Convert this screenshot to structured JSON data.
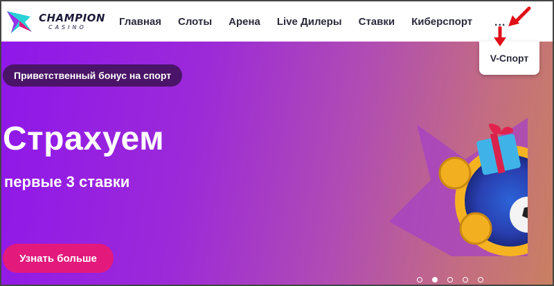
{
  "logo": {
    "name": "CHAMPION",
    "sub": "CASINO"
  },
  "nav": {
    "items": [
      {
        "label": "Главная"
      },
      {
        "label": "Слоты"
      },
      {
        "label": "Арена"
      },
      {
        "label": "Live Дилеры"
      },
      {
        "label": "Ставки"
      },
      {
        "label": "Киберспорт"
      }
    ],
    "more_label": "..."
  },
  "dropdown": {
    "item": "V-Спорт"
  },
  "banner": {
    "badge": "Приветственный бонус на спорт",
    "headline": "Страхуем",
    "subline": "первые 3 ставки",
    "cta": "Узнать больше",
    "slides_total": 5,
    "active_slide": 2
  },
  "colors": {
    "accent": "#e3197c",
    "annotation": "#e0101a",
    "banner_start": "#8f17ea",
    "banner_end": "#c98062"
  }
}
